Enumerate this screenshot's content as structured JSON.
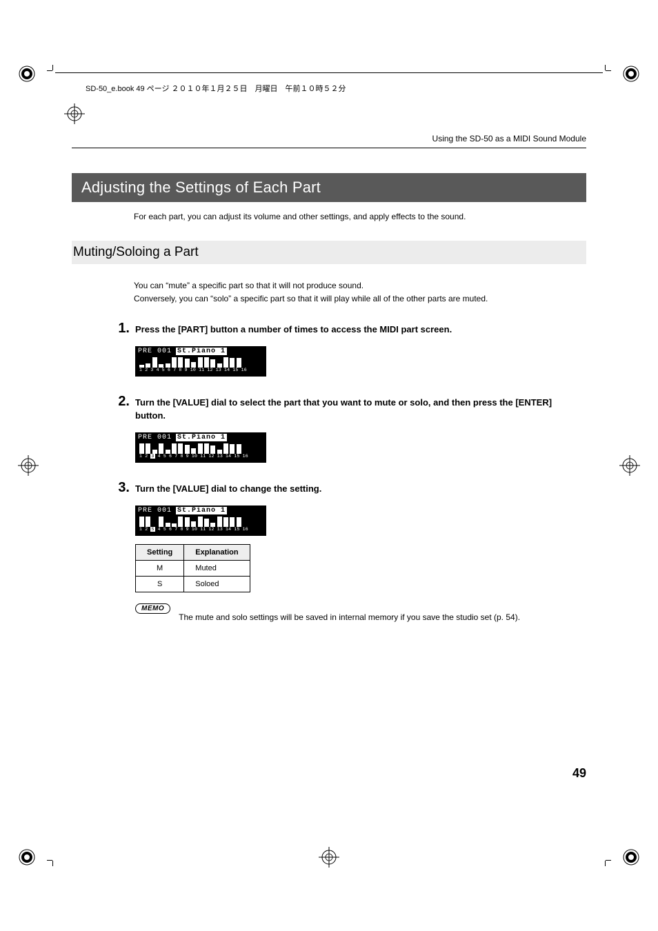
{
  "meta": {
    "book_info": "SD-50_e.book  49 ページ  ２０１０年１月２５日　月曜日　午前１０時５２分"
  },
  "header": {
    "running": "Using the SD-50 as a MIDI Sound Module"
  },
  "main_heading": "Adjusting the Settings of Each Part",
  "intro": "For each part, you can adjust its volume and other settings, and apply effects to the sound.",
  "sub_heading": "Muting/Soloing a Part",
  "description": {
    "line1": "You can “mute” a specific part so that it will not produce sound.",
    "line2": "Conversely, you can “solo” a specific part so that it will play while all of the other parts are muted."
  },
  "steps": {
    "s1": {
      "num": "1.",
      "text": "Press the [PART] button a number of times to access the MIDI part screen."
    },
    "s2": {
      "num": "2.",
      "text": "Turn the [VALUE] dial to select the part that you want to mute or solo, and then press the [ENTER] button."
    },
    "s3": {
      "num": "3.",
      "text": "Turn the [VALUE] dial to change the setting."
    }
  },
  "lcd": {
    "preset": "PRE 001",
    "patch_name": "St.Piano 1",
    "track_numbers_a": "1 2 3 4 5 6 7 8 9 10 11 12 13 14 15 16",
    "track_numbers_b": "1 2",
    "track_numbers_b_hl": "3",
    "track_numbers_b_rest": "4 5 6 7 8 9 10 11 12 13 14 15 16",
    "track_numbers_c_a": "1 2",
    "track_numbers_c_hl": "S",
    "track_numbers_c_rest": "4 5 6 7 8 9 10 11 12 13 14 15 16",
    "bars1": [
      4,
      6,
      15,
      5,
      6,
      15,
      15,
      13,
      8,
      15,
      15,
      12,
      6,
      15,
      14,
      14
    ],
    "bars2": [
      15,
      15,
      6,
      15,
      6,
      15,
      15,
      13,
      8,
      15,
      15,
      12,
      6,
      15,
      14,
      14
    ],
    "bars3": [
      15,
      15,
      0,
      15,
      6,
      5,
      15,
      14,
      8,
      15,
      12,
      6,
      15,
      14,
      14,
      14
    ]
  },
  "table": {
    "h1": "Setting",
    "h2": "Explanation",
    "rows": [
      {
        "setting": "M",
        "explanation": "Muted"
      },
      {
        "setting": "S",
        "explanation": "Soloed"
      }
    ]
  },
  "memo": {
    "label": "MEMO",
    "text": "The mute and solo settings will be saved in internal memory if you save the studio set (p. 54)."
  },
  "page_number": "49"
}
